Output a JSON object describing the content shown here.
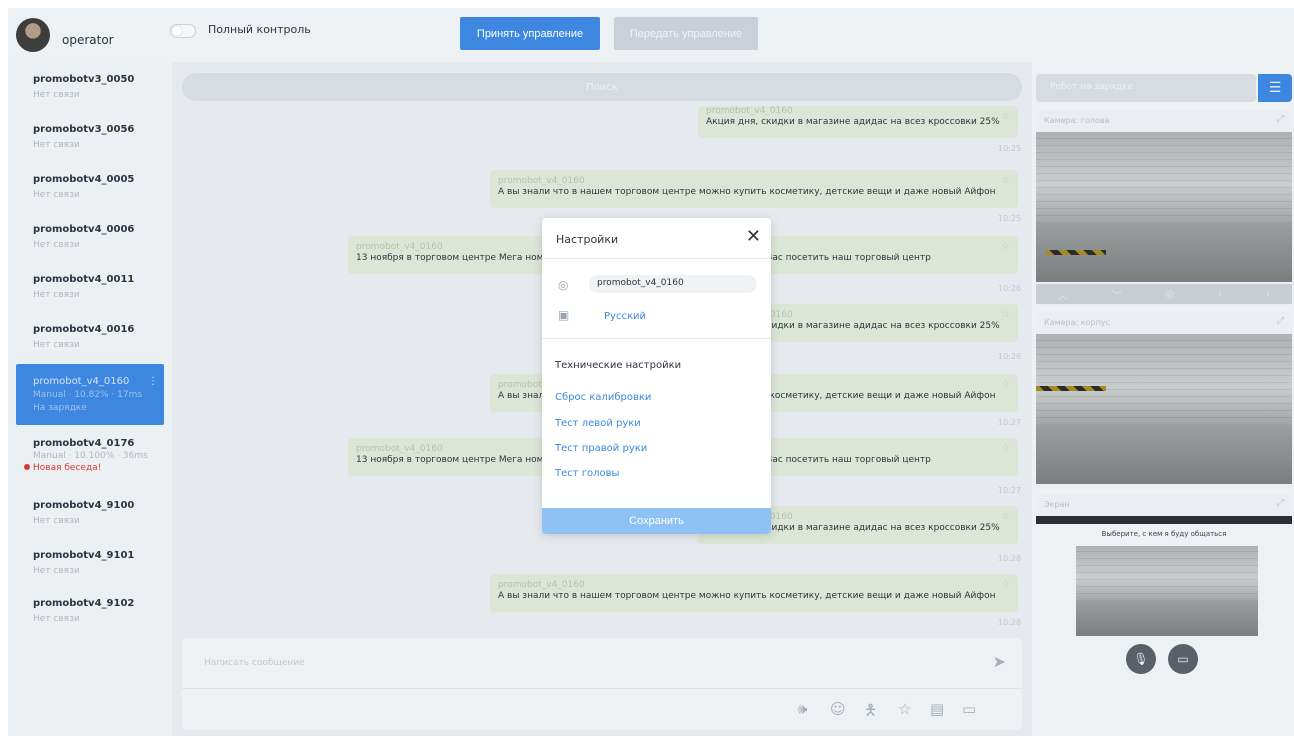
{
  "header": {
    "operator_name": "operator",
    "full_control_label": "Полный контроль",
    "accept_control_label": "Принять управление",
    "transfer_control_label": "Передать управление"
  },
  "sidebar": {
    "items": [
      {
        "name": "promobotv3_0050",
        "status": "Нет связи"
      },
      {
        "name": "promobotv3_0056",
        "status": "Нет связи"
      },
      {
        "name": "promobotv4_0005",
        "status": "Нет связи"
      },
      {
        "name": "promobotv4_0006",
        "status": "Нет связи"
      },
      {
        "name": "promobotv4_0011",
        "status": "Нет связи"
      },
      {
        "name": "promobotv4_0016",
        "status": "Нет связи"
      },
      {
        "name": "promobot_v4_0160",
        "status": "Manual · 10.82% · 17ms",
        "status2": "На зарядке"
      },
      {
        "name": "promobotv4_0176",
        "status": "Manual · 10.100% · 36ms",
        "new_chat": "Новая беседа!"
      },
      {
        "name": "promobotv4_9100",
        "status": "Нет связи"
      },
      {
        "name": "promobotv4_9101",
        "status": "Нет связи"
      },
      {
        "name": "promobotv4_9102",
        "status": "Нет связи"
      }
    ]
  },
  "chat": {
    "search_placeholder": "Поиск",
    "messages": [
      {
        "sender": "promobot_v4_0160",
        "text": "Акция дня, скидки в магазине адидас на всез кроссовки 25%",
        "time": "10:25"
      },
      {
        "sender": "promobot_v4_0160",
        "text": "А вы знали что в нашем торговом центре можно купить косметику, детские вещи и даже новый Айфон",
        "time": "10:25"
      },
      {
        "sender": "promobot_v4_0160",
        "text": "13 ноября в торговом центре Мега ном Уюта пройдет выставка мебели, приглашаем Вас посетить наш торговый центр",
        "time": "10:26"
      },
      {
        "sender": "promobot_v4_0160",
        "text": "Акция дня, скидки в магазине адидас на всез кроссовки 25%",
        "time": "10:26"
      },
      {
        "sender": "promobot_v4_0160",
        "text": "А вы знали что в нашем торговом центре можно купить косметику, детские вещи и даже новый Айфон",
        "time": "10:27"
      },
      {
        "sender": "promobot_v4_0160",
        "text": "13 ноября в торговом центре Мега ном Уюта пройдет выставка мебели, приглашаем Вас посетить наш торговый центр",
        "time": "10:27"
      },
      {
        "sender": "promobot_v4_0160",
        "text": "Акция дня, скидки в магазине адидас на всез кроссовки 25%",
        "time": "10:28"
      },
      {
        "sender": "promobot_v4_0160",
        "text": "А вы знали что в нашем торговом центре можно купить косметику, детские вещи и даже новый Айфон",
        "time": "10:28"
      }
    ],
    "composer_placeholder": "Написать сообщение"
  },
  "right_panel": {
    "robot_task_label": "Робот на зарядке",
    "camera_head_label": "Камера: голова",
    "camera_body_label": "Камера: корпус",
    "screen_label": "Экран",
    "screen_prompt": "Выберите, с кем я буду общаться"
  },
  "modal": {
    "title": "Настройки",
    "robot_name": "promobot_v4_0160",
    "language": "Русский",
    "tech_title": "Технические настройки",
    "links": [
      "Сброс калибровки",
      "Тест левой руки",
      "Тест правой руки",
      "Тест головы"
    ],
    "save_label": "Сохранить"
  },
  "colors": {
    "accent": "#3d87e0",
    "save": "#8ec2f5",
    "message_bg": "#dde6d6",
    "alert": "#d43a3a"
  }
}
